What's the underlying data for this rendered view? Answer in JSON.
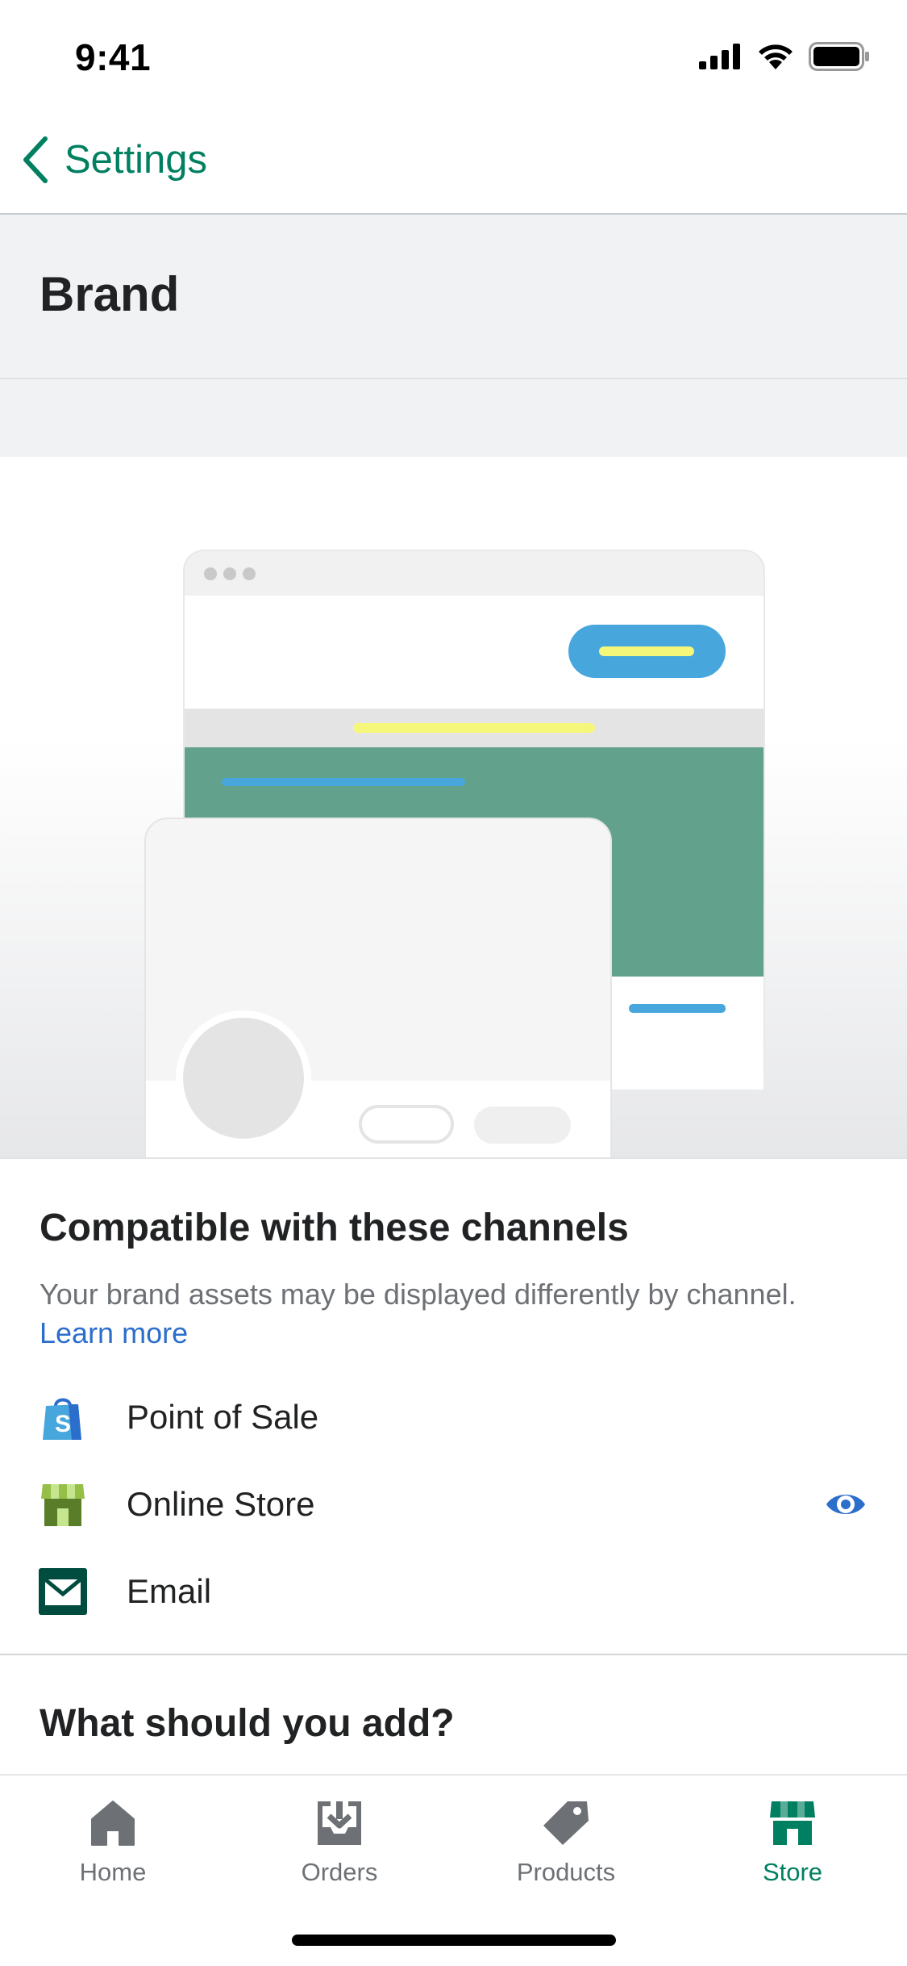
{
  "status_bar": {
    "time": "9:41"
  },
  "nav": {
    "back_label": "Settings"
  },
  "header": {
    "title": "Brand"
  },
  "channels_section": {
    "title": "Compatible with these channels",
    "description": "Your brand assets may be displayed differently by channel.",
    "learn_more": "Learn more",
    "channels": [
      {
        "label": "Point of Sale",
        "icon": "shopify-bag-icon"
      },
      {
        "label": "Online Store",
        "icon": "storefront-icon",
        "action_icon": "eye-icon"
      },
      {
        "label": "Email",
        "icon": "envelope-icon"
      }
    ]
  },
  "add_section": {
    "title": "What should you add?"
  },
  "tab_bar": {
    "tabs": [
      {
        "label": "Home",
        "icon": "home-icon"
      },
      {
        "label": "Orders",
        "icon": "orders-inbox-icon"
      },
      {
        "label": "Products",
        "icon": "tag-icon"
      },
      {
        "label": "Store",
        "icon": "store-icon",
        "active": true
      }
    ]
  },
  "colors": {
    "accent": "#008060",
    "link": "#2c6ecb",
    "illustration_green": "#62a18b",
    "illustration_blue": "#47a7dd",
    "illustration_yellow": "#f5f77a"
  }
}
